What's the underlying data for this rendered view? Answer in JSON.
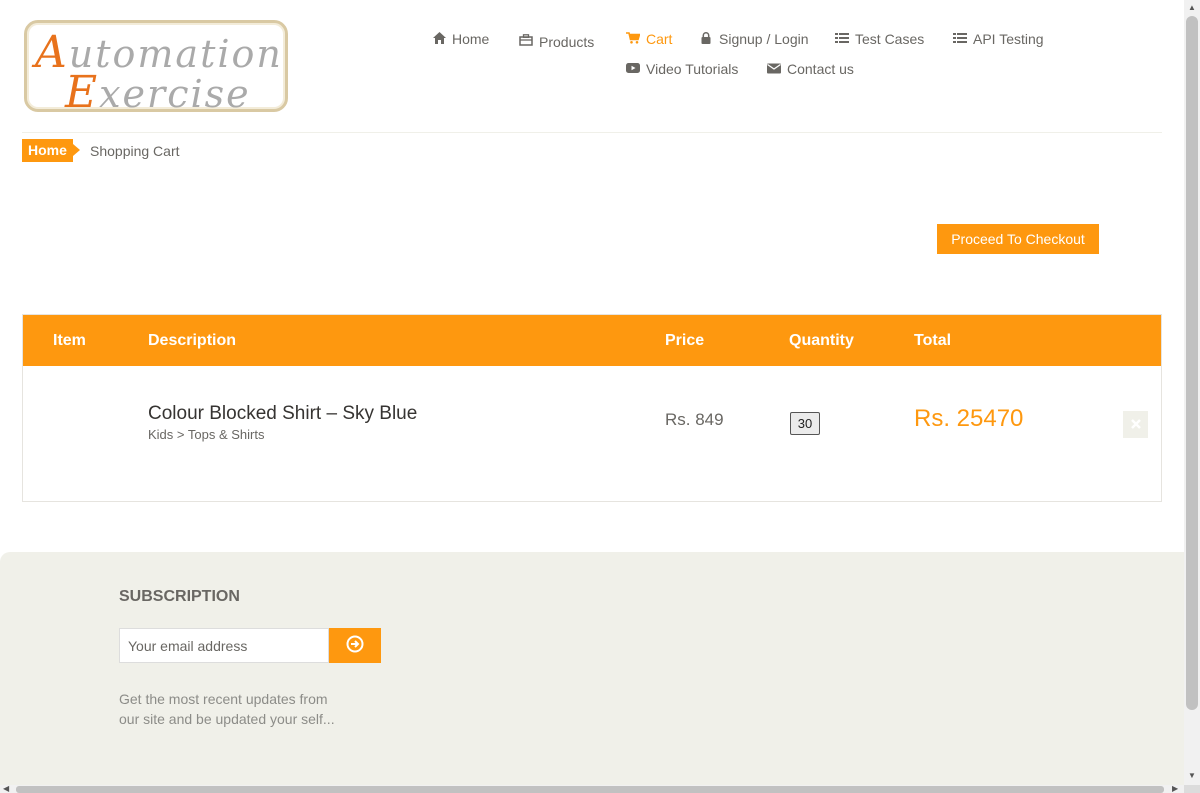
{
  "logo": {
    "line1_cap": "A",
    "line1_rest": "utomation",
    "line2_cap": "E",
    "line2_rest": "xercise"
  },
  "nav": {
    "home": {
      "label": "Home",
      "icon": "home-icon"
    },
    "products": {
      "label": "Products",
      "icon": "shirt-icon"
    },
    "cart": {
      "label": "Cart",
      "icon": "cart-icon"
    },
    "login": {
      "label": "Signup / Login",
      "icon": "lock-icon"
    },
    "test_cases": {
      "label": "Test Cases",
      "icon": "list-icon"
    },
    "api_testing": {
      "label": "API Testing",
      "icon": "list-icon"
    },
    "video": {
      "label": "Video Tutorials",
      "icon": "youtube-icon"
    },
    "contact": {
      "label": "Contact us",
      "icon": "envelope-icon"
    }
  },
  "breadcrumb": {
    "home": "Home",
    "current": "Shopping Cart"
  },
  "checkout_label": "Proceed To Checkout",
  "cart": {
    "headers": {
      "item": "Item",
      "description": "Description",
      "price": "Price",
      "quantity": "Quantity",
      "total": "Total"
    },
    "row": {
      "name": "Colour Blocked Shirt – Sky Blue",
      "category": "Kids > Tops & Shirts",
      "price": "Rs. 849",
      "quantity": "30",
      "total": "Rs. 25470",
      "delete_icon": "times-icon"
    }
  },
  "subscription": {
    "title": "SUBSCRIPTION",
    "placeholder": "Your email address",
    "button_icon": "arrow-circle-right-icon",
    "text": "Get the most recent updates from our site and be updated your self..."
  },
  "colors": {
    "accent": "#fe980f",
    "text": "#696763",
    "footer_bg": "#f0f0e9"
  }
}
